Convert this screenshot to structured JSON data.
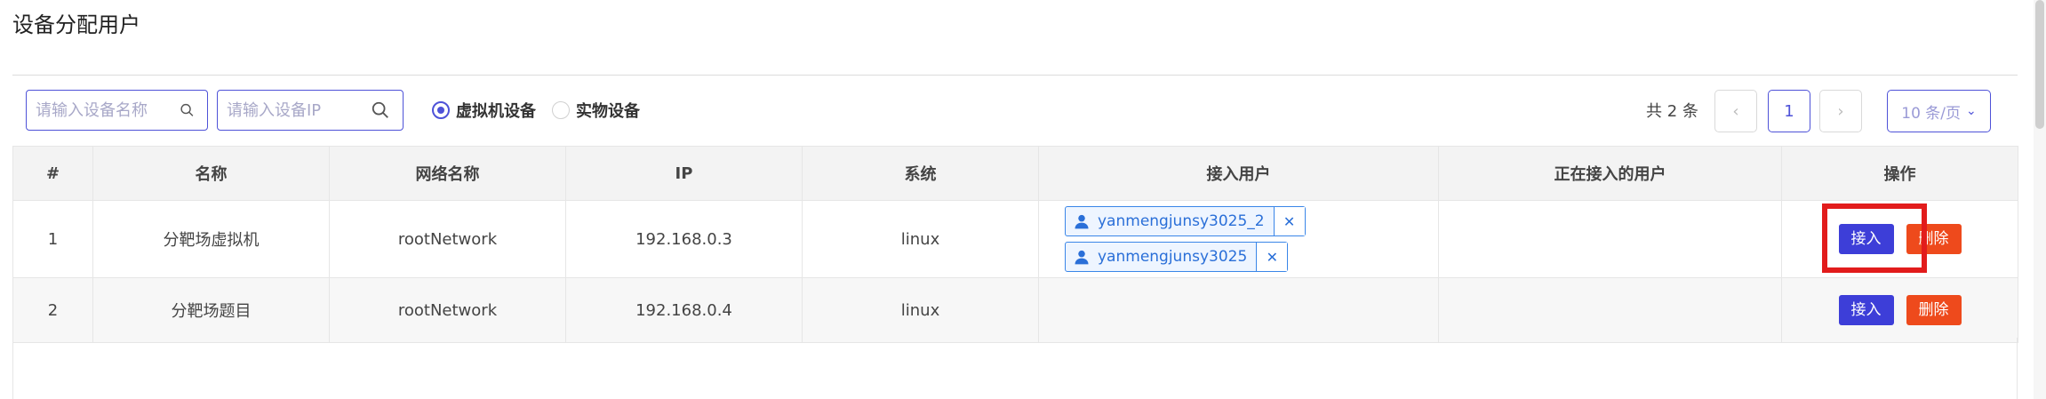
{
  "page": {
    "title": "设备分配用户"
  },
  "filters": {
    "device_name_placeholder": "请输入设备名称",
    "device_ip_placeholder": "请输入设备IP",
    "search_icon": "search-icon",
    "radios": [
      {
        "label": "虚拟机设备",
        "checked": true
      },
      {
        "label": "实物设备",
        "checked": false
      }
    ]
  },
  "pagination": {
    "total_text": "共 2 条",
    "prev": "‹",
    "current_page": "1",
    "next": "›",
    "page_size": "10 条/页",
    "page_size_icon": "chevron-down-icon"
  },
  "table": {
    "headers": [
      "#",
      "名称",
      "网络名称",
      "IP",
      "系统",
      "接入用户",
      "正在接入的用户",
      "操作"
    ],
    "rows": [
      {
        "index": "1",
        "name": "分靶场虚拟机",
        "network": "rootNetwork",
        "ip": "192.168.0.3",
        "os": "linux",
        "users": [
          "yanmengjunsy3025_2",
          "yanmengjunsy3025"
        ],
        "active_users": "",
        "connect_label": "接入",
        "delete_label": "删除"
      },
      {
        "index": "2",
        "name": "分靶场题目",
        "network": "rootNetwork",
        "ip": "192.168.0.4",
        "os": "linux",
        "users": [],
        "active_users": "",
        "connect_label": "接入",
        "delete_label": "删除"
      }
    ]
  },
  "colors": {
    "accent": "#4e52d8",
    "primary_button": "#3d3ed8",
    "danger_button": "#ee4a1c",
    "highlight": "#e21c1c",
    "tag": "#3a86e8"
  }
}
